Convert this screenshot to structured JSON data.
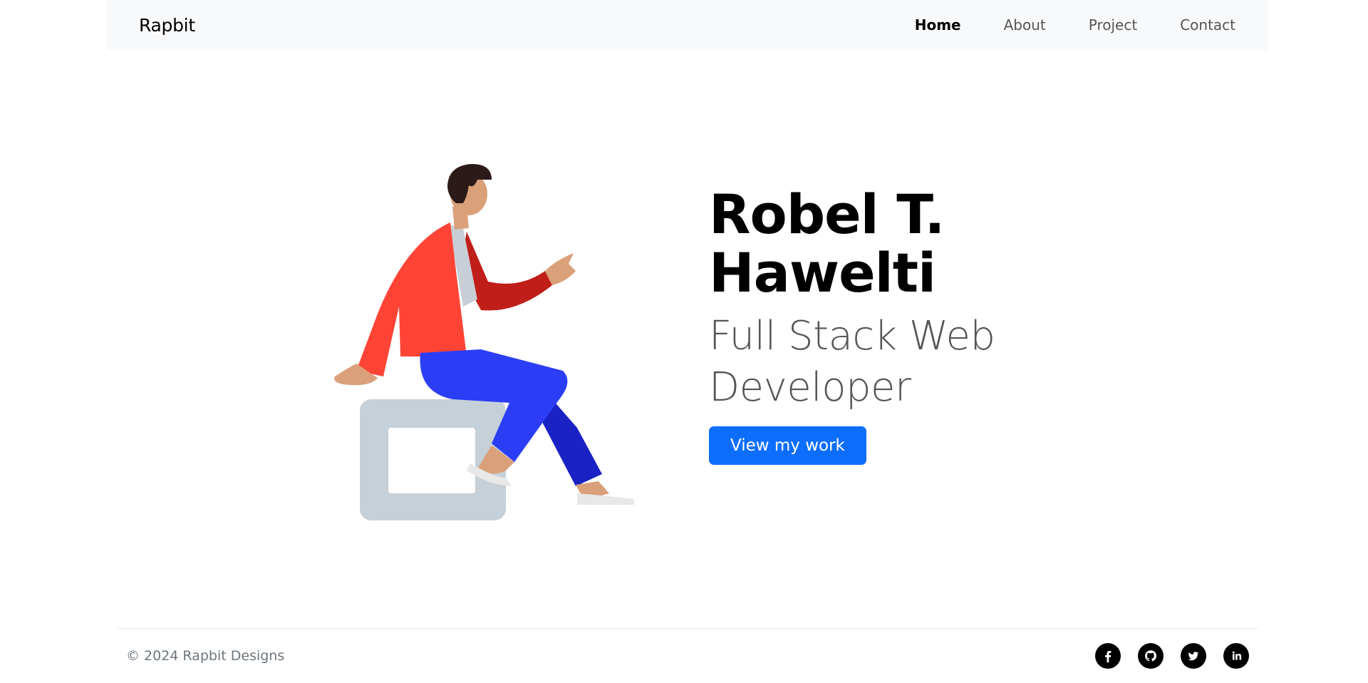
{
  "navbar": {
    "brand": "Rapbit",
    "links": [
      {
        "label": "Home",
        "active": true
      },
      {
        "label": "About",
        "active": false
      },
      {
        "label": "Project",
        "active": false
      },
      {
        "label": "Contact",
        "active": false
      }
    ]
  },
  "hero": {
    "name_line1": "Robel T.",
    "name_line2": "Hawelti",
    "role_line1": "Full Stack Web",
    "role_line2": "Developer",
    "cta_label": "View my work",
    "illustration": "person-sitting-on-stool"
  },
  "footer": {
    "copyright": "© 2024 Rapbit Designs",
    "socials": [
      "facebook-icon",
      "github-icon",
      "twitter-icon",
      "linkedin-icon"
    ]
  },
  "colors": {
    "accent": "#0d6efd",
    "navbar_bg": "#f8f9fa",
    "jacket": "#ff4436",
    "pants": "#2b3ef5",
    "stool": "#c5d0d8"
  }
}
